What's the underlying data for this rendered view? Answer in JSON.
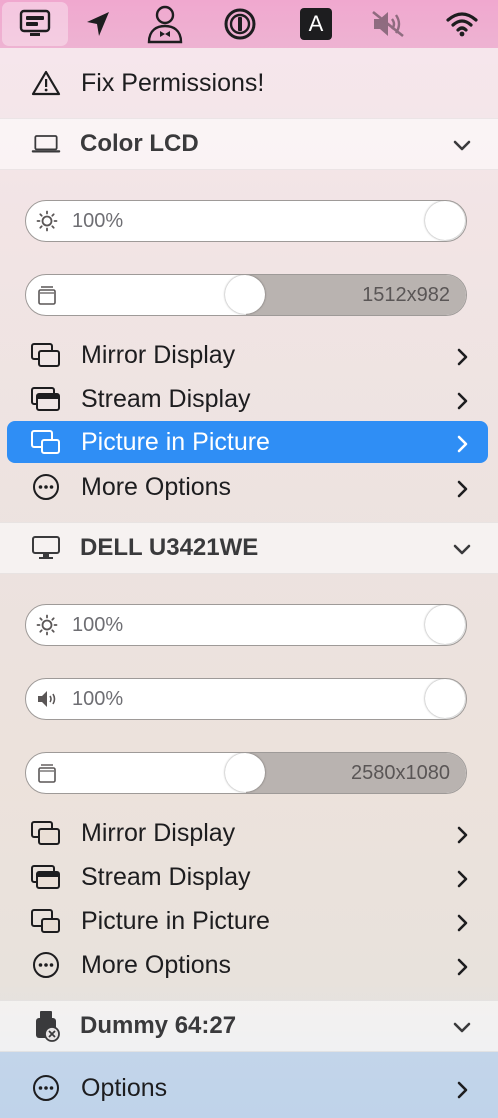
{
  "menubar": {
    "icons": [
      "display-menu-icon",
      "location-arrow-icon",
      "user-bowtie-icon",
      "one-password-icon",
      "keyboard-input-a-icon",
      "volume-muted-icon",
      "wifi-icon"
    ],
    "input_letter": "A"
  },
  "permissions": {
    "label": "Fix Permissions!"
  },
  "displays": [
    {
      "name": "Color LCD",
      "brightness": {
        "value": "100%",
        "level": 1.0
      },
      "resolution": {
        "value": "1512x982",
        "level": 0.55
      },
      "items": [
        {
          "label": "Mirror Display"
        },
        {
          "label": "Stream Display"
        },
        {
          "label": "Picture in Picture",
          "selected": true
        },
        {
          "label": "More Options"
        }
      ]
    },
    {
      "name": "DELL U3421WE",
      "brightness": {
        "value": "100%",
        "level": 1.0
      },
      "volume": {
        "value": "100%",
        "level": 1.0
      },
      "resolution": {
        "value": "2580x1080",
        "level": 0.55
      },
      "items": [
        {
          "label": "Mirror Display"
        },
        {
          "label": "Stream Display"
        },
        {
          "label": "Picture in Picture"
        },
        {
          "label": "More Options"
        }
      ]
    },
    {
      "name": "Dummy 64:27"
    }
  ],
  "footer": {
    "label": "Options"
  },
  "colors": {
    "menubar": "#eeb3d2",
    "selection": "#2f8ef5",
    "text": "#1d1d1f"
  }
}
